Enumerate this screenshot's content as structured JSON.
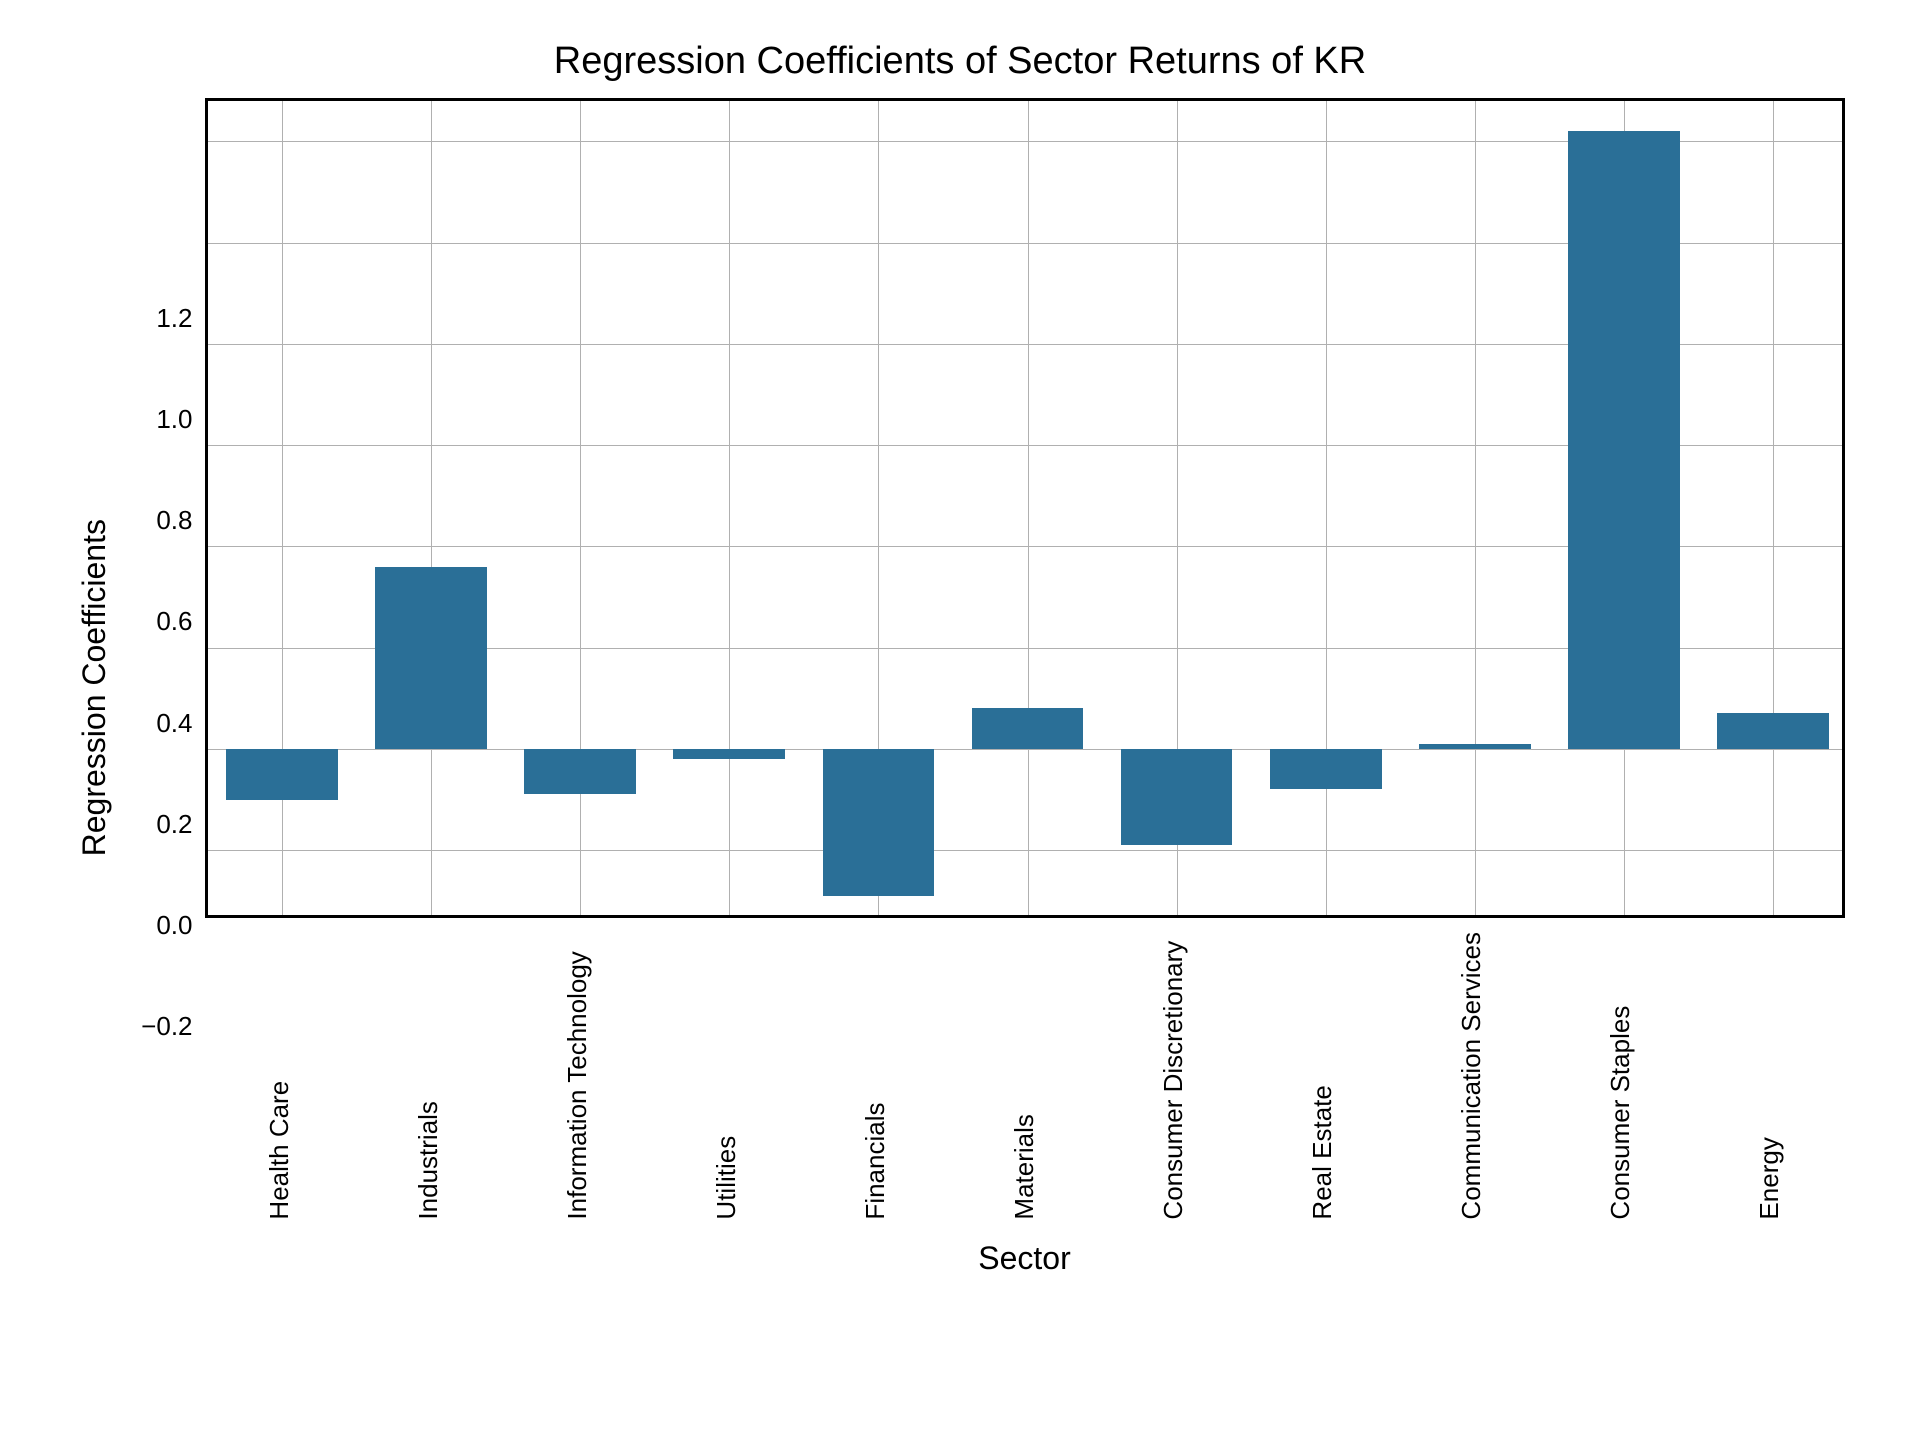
{
  "chart_data": {
    "type": "bar",
    "title": "Regression Coefficients of Sector Returns of KR",
    "xlabel": "Sector",
    "ylabel": "Regression Coefficients",
    "categories": [
      "Health Care",
      "Industrials",
      "Information Technology",
      "Utilities",
      "Financials",
      "Materials",
      "Consumer Discretionary",
      "Real Estate",
      "Communication Services",
      "Consumer Staples",
      "Energy"
    ],
    "values": [
      -0.1,
      0.36,
      -0.09,
      -0.02,
      -0.29,
      0.08,
      -0.19,
      -0.08,
      0.01,
      1.22,
      0.07
    ],
    "ylim": [
      -0.34,
      1.28
    ],
    "yticks": [
      -0.2,
      0.0,
      0.2,
      0.4,
      0.6,
      0.8,
      1.0,
      1.2
    ],
    "ytick_labels": [
      "−0.2",
      "0.0",
      "0.2",
      "0.4",
      "0.6",
      "0.8",
      "1.0",
      "1.2"
    ],
    "bar_color": "#2a6f97"
  }
}
